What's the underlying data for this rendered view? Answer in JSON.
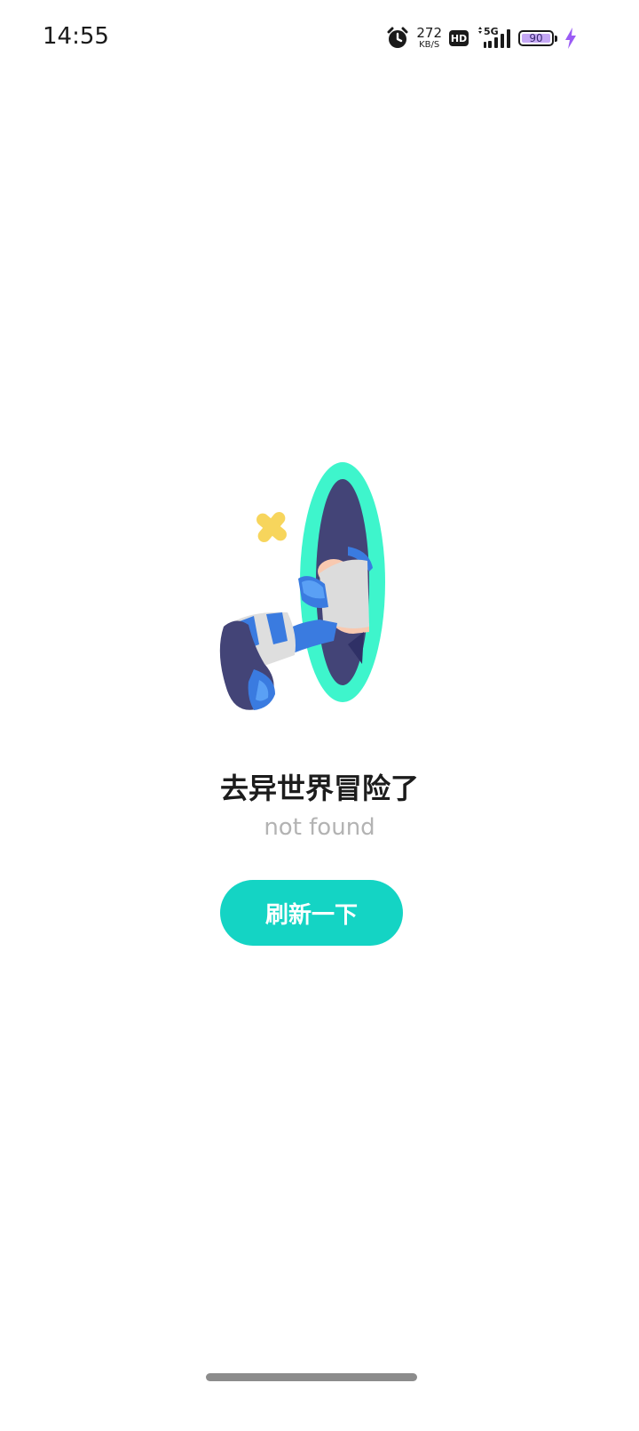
{
  "status_bar": {
    "time": "14:55",
    "net_speed_value": "272",
    "net_speed_unit": "KB/S",
    "hd_label": "HD",
    "network_label": "5G",
    "battery_level": "90",
    "icons": [
      "alarm-icon",
      "hd-icon",
      "signal-5g-icon",
      "battery-icon",
      "charging-icon"
    ]
  },
  "main": {
    "illustration": "portal-legs-illustration",
    "title": "去异世界冒险了",
    "subtitle": "not found",
    "refresh_button_label": "刷新一下"
  },
  "colors": {
    "accent": "#14d4c4",
    "portal_ring": "#3ef5cc",
    "portal_inner": "#434477",
    "sparkle": "#f7d55c",
    "battery_fill": "#c5a8f5",
    "charging": "#9b5cf5"
  }
}
